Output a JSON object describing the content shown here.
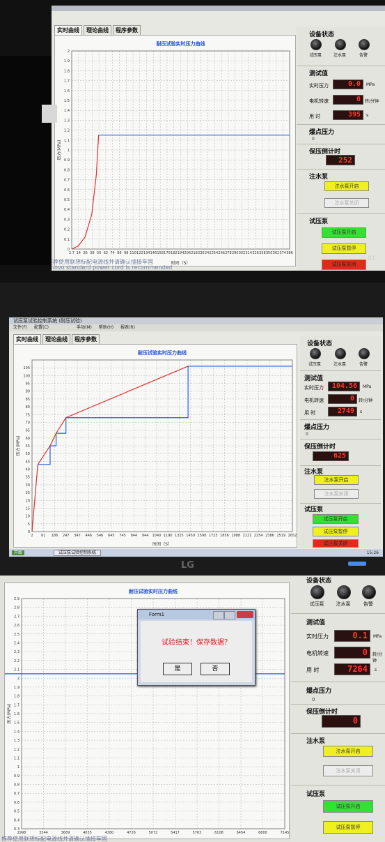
{
  "photo1": {
    "tabs": [
      "实时曲线",
      "理论曲线",
      "程序参数"
    ],
    "chart_title": "耐压试验实时压力曲线",
    "xlabel": "时间（S）",
    "ylabel": "压力(MPa)",
    "device_status": "设备状态",
    "lamps": [
      "试压泵",
      "注水泵",
      "告警"
    ],
    "measure_title": "测试值",
    "pressure_label": "实时压力",
    "pressure_value": "0.0",
    "pressure_unit": "MPa",
    "speed_label": "电机转速",
    "speed_value": "0",
    "speed_unit": "转/分钟",
    "time_label": "用  时",
    "time_value": "395",
    "time_unit": "s",
    "burst_title": "爆点压力",
    "burst_value": "0",
    "countdown_title": "保压倒计时",
    "countdown_value": "252",
    "water_pump_title": "注水泵",
    "water_on": "注水泵开启",
    "water_off": "注水泵关闭",
    "test_pump_title": "试压泵",
    "test_on": "试压泵开启",
    "test_stop": "试压泵暂停",
    "test_off": "试压泵关闭",
    "overlay1": "推荐使用联想标配电源线并请确认插接牢固",
    "overlay2": "enovo standard power cord is recommended",
    "corner": "01"
  },
  "photo2": {
    "window_title": "试压泵试验控制系统  (耐压试验)",
    "menu": [
      "文件(F)",
      "配置(C)",
      "手动(M)",
      "帮助(H)",
      "报表(R)"
    ],
    "tabs": [
      "实时曲线",
      "理论曲线",
      "程序参数"
    ],
    "chart_title": "耐压试验实时压力曲线",
    "xlabel": "时间（S）",
    "ylabel": "压力(MPa)",
    "device_status": "设备状态",
    "lamps": [
      "试压泵",
      "注水泵",
      "告警"
    ],
    "measure_title": "测试值",
    "pressure_label": "实时压力",
    "pressure_value": "104.56",
    "pressure_unit": "MPa",
    "speed_label": "电机转速",
    "speed_value": "0",
    "speed_unit": "转/分钟",
    "time_label": "用  时",
    "time_value": "2749",
    "time_unit": "s",
    "burst_title": "爆点压力",
    "burst_value": "0",
    "countdown_title": "保压倒计时",
    "countdown_value": "625",
    "water_pump_title": "注水泵",
    "water_on": "注水泵开启",
    "water_off": "注水泵关闭",
    "test_pump_title": "试压泵",
    "test_on": "试压泵开启",
    "test_stop": "试压泵暂停",
    "test_off": "试压泵关闭",
    "taskbar_start": "开始",
    "taskbar_item": "试压泵试验控制系统",
    "taskbar_clock": "15:26",
    "monitor_logo": "LG"
  },
  "photo3": {
    "chart_title": "耐压试验实时压力曲线",
    "ylabel": "压力(MPa)",
    "device_status": "设备状态",
    "lamps": [
      "试压泵",
      "注水泵",
      "告警"
    ],
    "measure_title": "测试值",
    "pressure_label": "实时压力",
    "pressure_value": "0.1",
    "pressure_unit": "MPa",
    "speed_label": "电机转速",
    "speed_value": "0",
    "speed_unit": "转/分钟",
    "time_label": "用  时",
    "time_value": "7264",
    "time_unit": "s",
    "burst_title": "爆点压力",
    "burst_value": "0",
    "countdown_title": "保压倒计时",
    "countdown_value": "0",
    "water_pump_title": "注水泵",
    "water_on": "注水泵开启",
    "water_off": "注水泵关闭",
    "test_pump_title": "试压泵",
    "test_on": "试压泵开启",
    "test_stop": "试压泵暂停",
    "dialog_title": "Form1",
    "dialog_message": "试验结束！保存数据？",
    "dialog_yes": "是",
    "dialog_no": "否",
    "overlay": "推荐使用联想标配电源线并请确认插接牢固"
  },
  "chart_data": [
    {
      "type": "line",
      "title": "耐压试验实时压力曲线",
      "xlabel": "时间（S）",
      "ylabel": "压力(MPa)",
      "xtick_labels": [
        "2.7",
        "14",
        "26",
        "38",
        "50",
        "62",
        "74",
        "86",
        "98",
        "110",
        "122",
        "134",
        "146",
        "158",
        "170",
        "182",
        "194",
        "206",
        "218",
        "230",
        "242",
        "254",
        "266",
        "278",
        "290",
        "302",
        "314",
        "326",
        "338",
        "350",
        "362",
        "374",
        "386"
      ],
      "ylim": [
        0,
        2
      ],
      "yticks": [
        0,
        0.1,
        0.2,
        0.3,
        0.4,
        0.5,
        0.6,
        0.7,
        0.8,
        0.9,
        1,
        1.1,
        1.2,
        1.3,
        1.4,
        1.5,
        1.6,
        1.7,
        1.8,
        1.9,
        2
      ],
      "xlim": [
        2.7,
        386
      ],
      "grid": true,
      "series": [
        {
          "color": "#2060e0",
          "x": [
            50,
            386
          ],
          "y": [
            1.15,
            1.15
          ]
        },
        {
          "color": "#e03030",
          "x": [
            2.7,
            14,
            26,
            38,
            46,
            50
          ],
          "y": [
            0,
            0.03,
            0.12,
            0.35,
            0.75,
            1.15
          ]
        }
      ]
    },
    {
      "type": "line",
      "title": "耐压试验实时压力曲线",
      "xlabel": "时间（S）",
      "ylabel": "压力(MPa)",
      "xtick_labels": [
        "2",
        "61",
        "186",
        "247",
        "347",
        "446",
        "546",
        "645",
        "745",
        "844",
        "944",
        "1040",
        "1190",
        "1325",
        "1459",
        "1590",
        "1723",
        "1856",
        "1988",
        "2121",
        "2254",
        "2386",
        "2519",
        "2652"
      ],
      "ylim": [
        0,
        110
      ],
      "yticks": [
        0,
        5,
        10,
        15,
        20,
        25,
        30,
        35,
        40,
        45,
        50,
        55,
        60,
        65,
        70,
        75,
        80,
        85,
        90,
        95,
        100,
        105
      ],
      "xlim": [
        2,
        2652
      ],
      "grid": true,
      "series": [
        {
          "color": "#2060e0",
          "x": [
            61,
            186,
            186,
            247,
            247,
            347,
            347,
            1590,
            1590,
            2652
          ],
          "y": [
            43,
            43,
            55,
            55,
            63,
            63,
            73,
            73,
            106,
            106
          ]
        },
        {
          "color": "#e03030",
          "x": [
            2,
            61,
            186,
            247,
            347,
            1590
          ],
          "y": [
            0,
            43,
            55,
            63,
            73,
            106
          ]
        }
      ]
    },
    {
      "type": "line",
      "title": "耐压试验实时压力曲线",
      "ylabel": "压力(MPa)",
      "xtick_labels": [
        "2998",
        "3344",
        "3689",
        "4035",
        "4380",
        "4726",
        "5072",
        "5417",
        "5763",
        "6108",
        "6454",
        "6800",
        "7145"
      ],
      "ylim": [
        0.3,
        2.9
      ],
      "yticks": [
        0.3,
        0.4,
        0.5,
        0.6,
        0.7,
        0.8,
        0.9,
        1,
        1.1,
        1.2,
        1.3,
        1.4,
        1.5,
        1.6,
        1.7,
        1.8,
        1.9,
        2,
        2.1,
        2.2,
        2.3,
        2.4,
        2.5,
        2.6,
        2.7,
        2.8,
        2.9
      ],
      "grid": true,
      "series": [
        {
          "color": "#2060e0",
          "x": [
            0,
            310,
            310,
            650,
            650,
            7145
          ],
          "y": [
            1.0,
            1.0,
            1.55,
            1.55,
            2.05,
            2.05
          ]
        },
        {
          "color": "#e03030",
          "x": [
            0,
            20,
            310,
            650
          ],
          "y": [
            0.3,
            1.0,
            1.55,
            2.05
          ]
        }
      ]
    }
  ]
}
